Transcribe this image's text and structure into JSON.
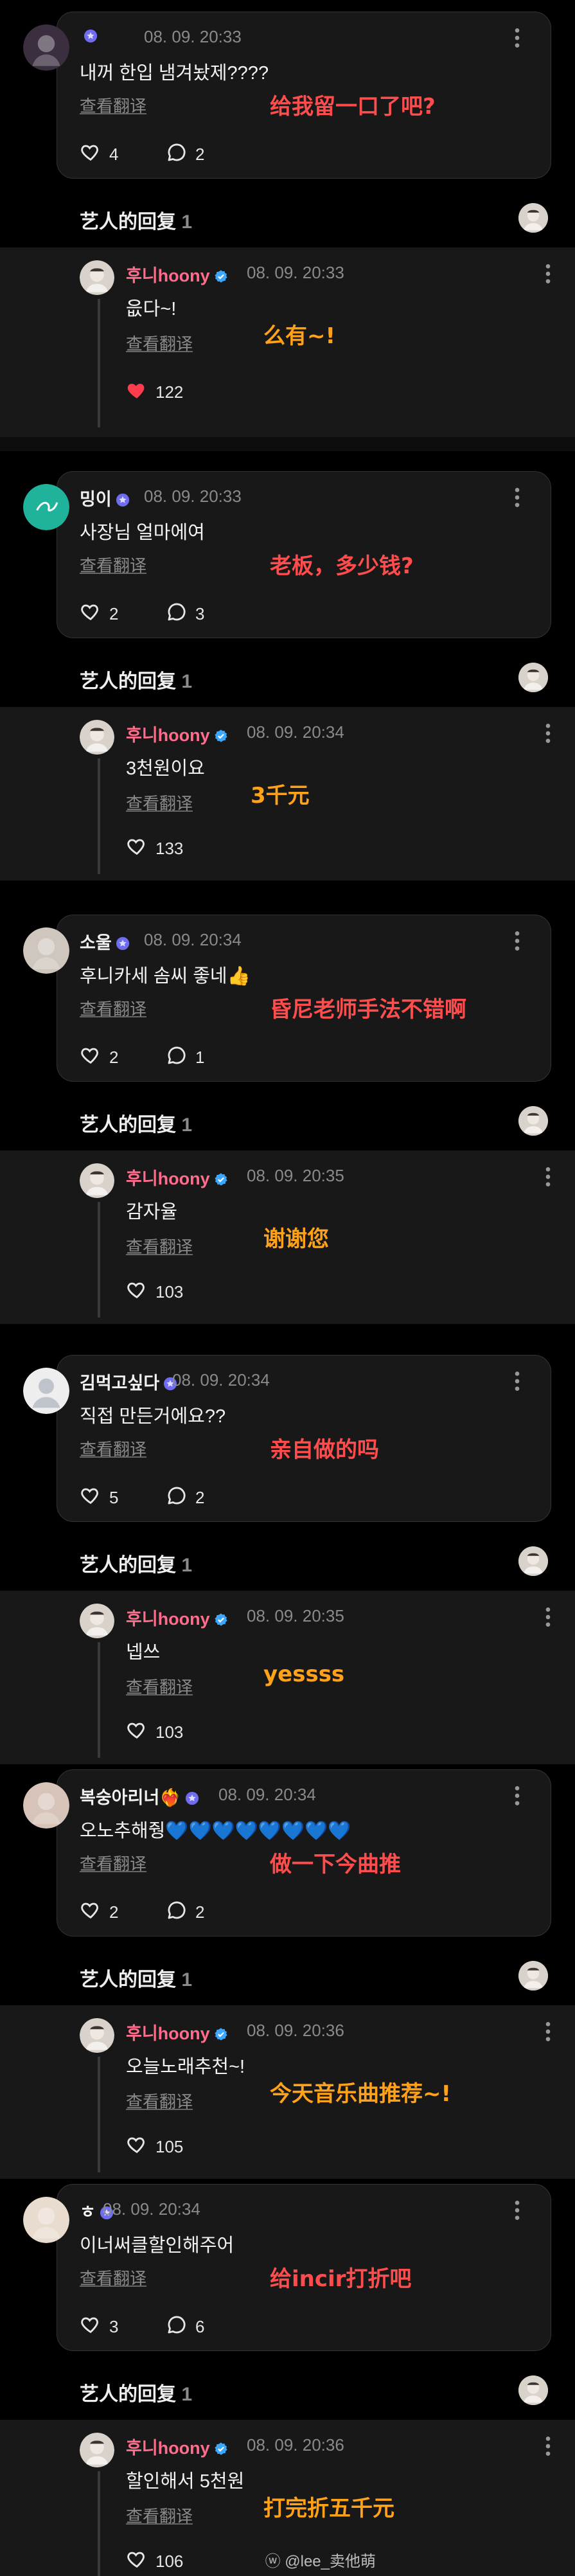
{
  "ui": {
    "translate_label": "查看翻译",
    "replies_section_label": "艺人的回复",
    "replies_count": "1",
    "artist_name": "후니hoony"
  },
  "threads": [
    {
      "comment": {
        "user": "",
        "time": "08. 09. 20:33",
        "text": "내꺼 한입 냄겨놨제????",
        "likes": "4",
        "replies": "2",
        "caption": "给我留一口了吧?"
      },
      "reply": {
        "time": "08. 09. 20:33",
        "text": "읎다~!",
        "likes": "122",
        "liked": true,
        "caption": "么有~!"
      }
    },
    {
      "comment": {
        "user": "밍이",
        "time": "08. 09. 20:33",
        "text": "사장님 얼마에여",
        "likes": "2",
        "replies": "3",
        "caption": "老板，多少钱?"
      },
      "reply": {
        "time": "08. 09. 20:34",
        "text": "3천원이요",
        "likes": "133",
        "liked": false,
        "caption": "3千元"
      }
    },
    {
      "comment": {
        "user": "소울",
        "time": "08. 09. 20:34",
        "text": "후니카세 솜씨 좋네👍",
        "likes": "2",
        "replies": "1",
        "caption": "昏尼老师手法不错啊"
      },
      "reply": {
        "time": "08. 09. 20:35",
        "text": "감자율",
        "likes": "103",
        "liked": false,
        "caption": "谢谢您"
      }
    },
    {
      "comment": {
        "user": "김먹고싶다",
        "time": "08. 09. 20:34",
        "text": "직접 만든거에요??",
        "likes": "5",
        "replies": "2",
        "caption": "亲自做的吗"
      },
      "reply": {
        "time": "08. 09. 20:35",
        "text": "넵쓰",
        "likes": "103",
        "liked": false,
        "caption": "yessss"
      }
    },
    {
      "comment": {
        "user": "복숭아리너❤️‍🔥",
        "time": "08. 09. 20:34",
        "text": "오노추해줭💙💙💙💙💙💙💙💙",
        "likes": "2",
        "replies": "2",
        "caption": "做一下今曲推"
      },
      "reply": {
        "time": "08. 09. 20:36",
        "text": "오늘노래추천~!",
        "likes": "105",
        "liked": false,
        "caption": "今天音乐曲推荐~!"
      }
    },
    {
      "comment": {
        "user": "ㅎ",
        "time": "08. 09. 20:34",
        "text": "이너써클할인해주어",
        "likes": "3",
        "replies": "6",
        "caption": "给incir打折吧"
      },
      "reply": {
        "time": "08. 09. 20:36",
        "text": "할인해서 5천원",
        "likes": "106",
        "liked": false,
        "caption": "打完折五千元"
      }
    }
  ],
  "watermark": "@lee_卖他萌",
  "colors": {
    "accent_artist": "#ff6c8c",
    "caption_red": "#ff4d4d",
    "caption_orange": "#ffa21a",
    "heart_liked": "#ff3b4e",
    "badge": "#6f6cf0"
  }
}
